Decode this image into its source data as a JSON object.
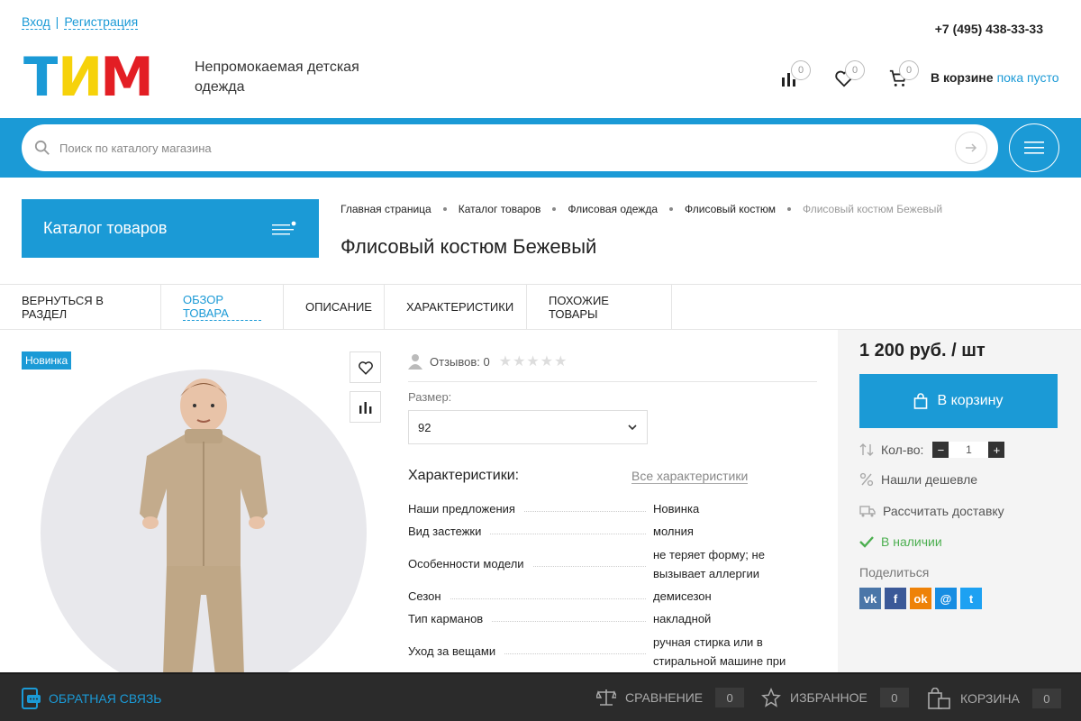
{
  "auth": {
    "login": "Вход",
    "separator": "|",
    "register": "Регистрация"
  },
  "phone": "+7 (495) 438-33-33",
  "logo": {
    "letters": [
      "Т",
      "И",
      "М"
    ],
    "colors": [
      "#1b9ad6",
      "#f6d20a",
      "#e31e24"
    ]
  },
  "tagline": "Непромокаемая детская одежда",
  "header": {
    "compare_count": "0",
    "favorites_count": "0",
    "cart_count": "0",
    "cart_label": "В корзине",
    "cart_status": "пока пусто"
  },
  "search": {
    "placeholder": "Поиск по каталогу магазина"
  },
  "catalog_button": "Каталог товаров",
  "breadcrumb": [
    "Главная страница",
    "Каталог товаров",
    "Флисовая одежда",
    "Флисовый костюм",
    "Флисовый костюм Бежевый"
  ],
  "page_title": "Флисовый костюм Бежевый",
  "tabs": [
    "Вернуться в раздел",
    "Обзор товара",
    "Описание",
    "Характеристики",
    "Похожие товары"
  ],
  "product": {
    "badge": "Новинка",
    "reviews": "Отзывов: 0",
    "size_label": "Размер:",
    "size_value": "92",
    "characteristics_title": "Характеристики:",
    "all_characteristics": "Все характеристики",
    "properties": [
      {
        "name": "Наши предложения",
        "value": "Новинка"
      },
      {
        "name": "Вид застежки",
        "value": "молния"
      },
      {
        "name": "Особенности модели",
        "value": "не теряет форму; не вызывает аллергии"
      },
      {
        "name": "Сезон",
        "value": "демисезон"
      },
      {
        "name": "Тип карманов",
        "value": "накладной"
      },
      {
        "name": "Уход за вещами",
        "value": "ручная стирка или в стиральной машине при"
      }
    ]
  },
  "purchase": {
    "price": "1 200 руб. / шт",
    "buy_label": "В корзину",
    "qty_label": "Кол-во:",
    "qty_minus": "−",
    "qty_value": "1",
    "qty_plus": "+",
    "cheaper": "Нашли дешевле",
    "delivery": "Рассчитать доставку",
    "stock": "В наличии",
    "share": "Поделиться",
    "socials": [
      {
        "name": "vk",
        "label": "vk",
        "color": "#4a76a8"
      },
      {
        "name": "facebook",
        "label": "f",
        "color": "#3b5998"
      },
      {
        "name": "odnoklassniki",
        "label": "ok",
        "color": "#ee8208"
      },
      {
        "name": "mail",
        "label": "@",
        "color": "#168de2"
      },
      {
        "name": "twitter",
        "label": "t",
        "color": "#1da1f2"
      }
    ]
  },
  "bottom_bar": {
    "feedback": "Обратная связь",
    "compare": "Сравнение",
    "compare_count": "0",
    "favorites": "Избранное",
    "favorites_count": "0",
    "cart": "Корзина",
    "cart_count": "0"
  },
  "colors": {
    "accent": "#1b9ad6",
    "stock": "#4caf50"
  }
}
